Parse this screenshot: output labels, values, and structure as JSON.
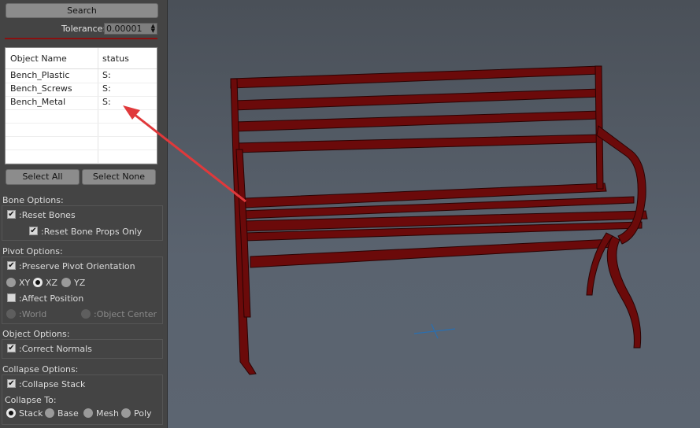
{
  "search": {
    "label": "Search"
  },
  "tolerance": {
    "label": "Tolerance:",
    "value": "0.00001"
  },
  "list": {
    "headers": [
      "Object Name",
      "status"
    ],
    "rows": [
      {
        "name": "Bench_Plastic",
        "status": "S:"
      },
      {
        "name": "Bench_Screws",
        "status": "S:"
      },
      {
        "name": "Bench_Metal",
        "status": "S:"
      }
    ]
  },
  "select": {
    "all": "Select All",
    "none": "Select None"
  },
  "bone": {
    "title": "Bone Options:",
    "reset_bones": ":Reset Bones",
    "reset_props": ":Reset Bone Props Only"
  },
  "pivot": {
    "title": "Pivot Options:",
    "preserve": ":Preserve Pivot Orientation",
    "axes": [
      "XY",
      "XZ",
      "YZ"
    ],
    "axis_selected": "XZ",
    "affect": ":Affect Position",
    "world": ":World",
    "object_center": ":Object Center"
  },
  "object": {
    "title": "Object Options:",
    "correct_normals": ":Correct Normals"
  },
  "collapse": {
    "title": "Collapse Options:",
    "collapse_stack": ":Collapse Stack",
    "collapse_to": "Collapse To:",
    "targets": [
      "Stack",
      "Base",
      "Mesh",
      "Poly"
    ],
    "target_selected": "Stack"
  },
  "colors": {
    "bench": "#6b0a0a",
    "arrow": "#e0393b",
    "gizmo": "#2a6fb0"
  }
}
